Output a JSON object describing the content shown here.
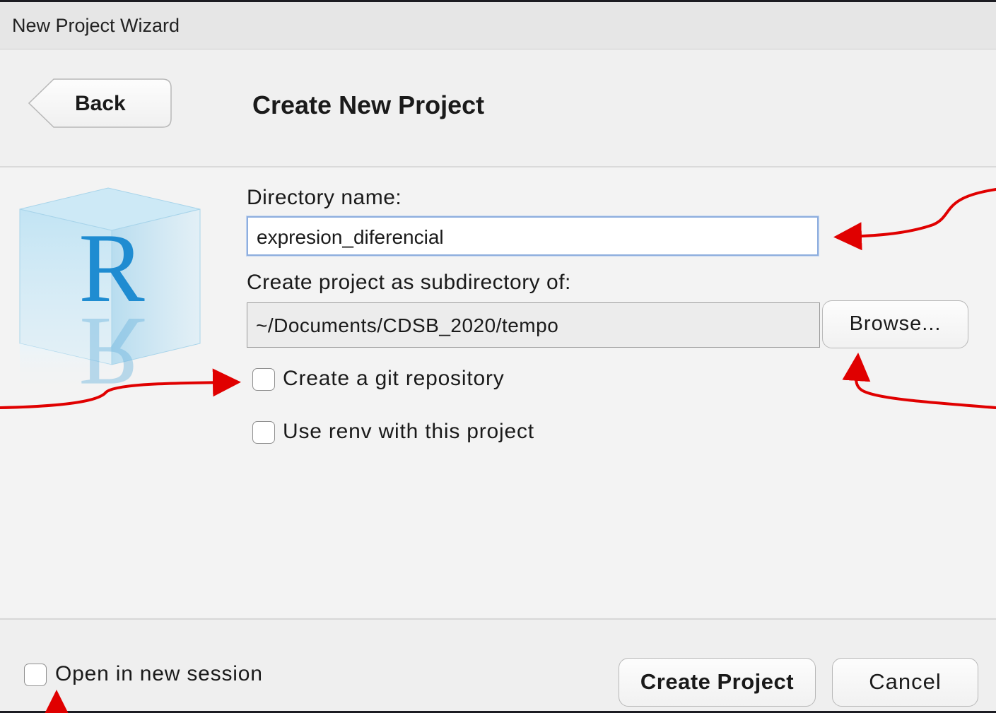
{
  "window": {
    "title": "New Project Wizard"
  },
  "header": {
    "back_label": "Back",
    "page_title": "Create New Project"
  },
  "form": {
    "directory_label": "Directory name:",
    "directory_value": "expresion_diferencial",
    "parent_label": "Create project as subdirectory of:",
    "parent_value": "~/Documents/CDSB_2020/tempo",
    "browse_label": "Browse...",
    "git_label": "Create a git repository",
    "git_checked": false,
    "renv_label": "Use renv with this project",
    "renv_checked": false
  },
  "footer": {
    "new_session_label": "Open in new session",
    "new_session_checked": false,
    "create_label": "Create Project",
    "cancel_label": "Cancel"
  },
  "logo": {
    "letter": "R",
    "icon": "r-logo-cube-icon"
  },
  "annotations": {
    "color": "#e00000",
    "icon": "red-arrow-icon"
  }
}
